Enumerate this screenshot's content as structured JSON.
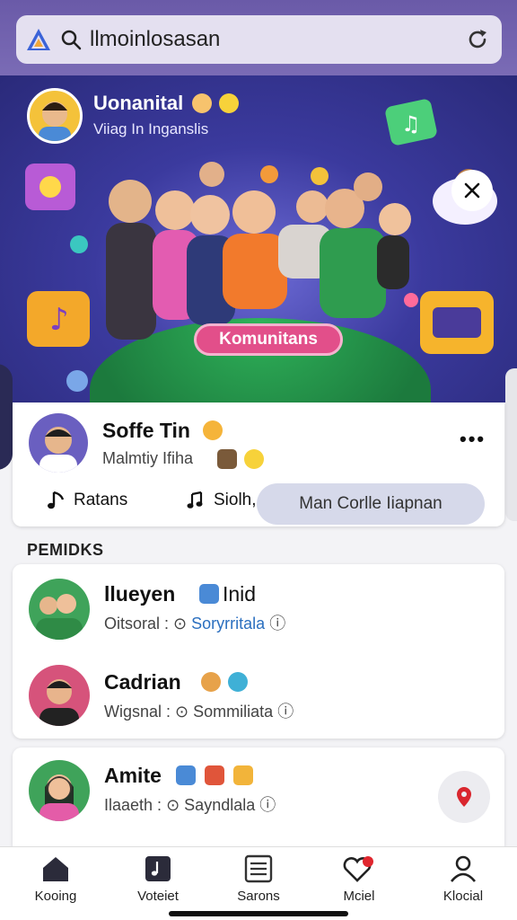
{
  "search": {
    "text": "llmoinlosasan"
  },
  "hero": {
    "title": "Uonanital",
    "subtitle": "Viiag In Inganslis",
    "badge": "Komunitans"
  },
  "profile": {
    "name": "Soffe Tin",
    "subtitle": "Malmtiy Ifiha",
    "btn_left": "Ratans",
    "btn_mid": "Siolh,",
    "pill": "Man Corlle Iiapnan"
  },
  "section_title": "PEMIDKS",
  "list": [
    {
      "name": "llueyen",
      "tag": "Inid",
      "sub_label": "Oitsoral :",
      "sub_link": "Soryrritala"
    },
    {
      "name": "Cadrian",
      "tag": "",
      "sub_label": "Wigsnal :",
      "sub_link": "Sommiliata"
    },
    {
      "name": "Amite",
      "tag": "",
      "sub_label": "Ilaaeth :",
      "sub_link": "Sayndlala"
    }
  ],
  "nav": [
    {
      "label": "Kooing",
      "icon": "home-icon"
    },
    {
      "label": "Voteiet",
      "icon": "music-square-icon"
    },
    {
      "label": "Sarons",
      "icon": "list-icon"
    },
    {
      "label": "Mciel",
      "icon": "heart-location-icon"
    },
    {
      "label": "Klocial",
      "icon": "profile-icon"
    }
  ],
  "colors": {
    "accent": "#6a5aa8",
    "link": "#2b6fbf",
    "badge": "#e24f8a"
  }
}
